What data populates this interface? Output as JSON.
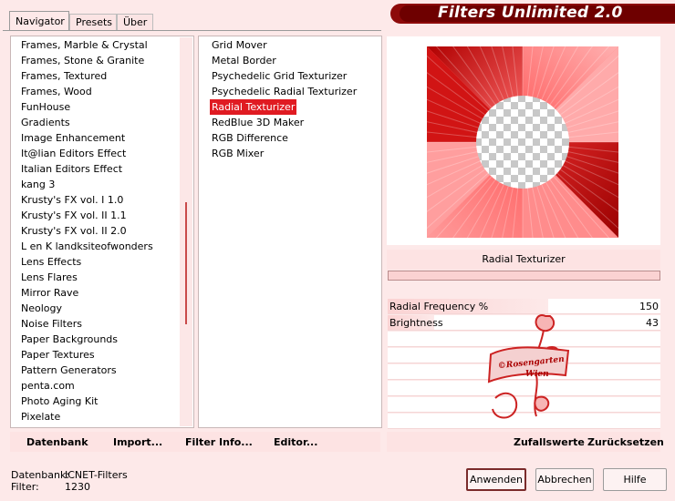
{
  "app": {
    "title": "Filters Unlimited 2.0"
  },
  "tabs": [
    {
      "label": "Navigator"
    },
    {
      "label": "Presets"
    },
    {
      "label": "Über"
    }
  ],
  "categories": [
    "Frames, Marble & Crystal",
    "Frames, Stone & Granite",
    "Frames, Textured",
    "Frames, Wood",
    "FunHouse",
    "Gradients",
    "Image Enhancement",
    "It@lian Editors Effect",
    "Italian Editors Effect",
    "kang 3",
    "Krusty's FX vol. I 1.0",
    "Krusty's FX vol. II 1.1",
    "Krusty's FX vol. II 2.0",
    "L en K landksiteofwonders",
    "Lens Effects",
    "Lens Flares",
    "Mirror Rave",
    "Neology",
    "Noise Filters",
    "Paper Backgrounds",
    "Paper Textures",
    "Pattern Generators",
    "penta.com",
    "Photo Aging Kit",
    "Pixelate"
  ],
  "filters": [
    {
      "label": "Grid Mover",
      "selected": false
    },
    {
      "label": "Metal Border",
      "selected": false
    },
    {
      "label": "Psychedelic Grid Texturizer",
      "selected": false
    },
    {
      "label": "Psychedelic Radial Texturizer",
      "selected": false
    },
    {
      "label": "Radial Texturizer",
      "selected": true
    },
    {
      "label": "RedBlue 3D Maker",
      "selected": false
    },
    {
      "label": "RGB Difference",
      "selected": false
    },
    {
      "label": "RGB Mixer",
      "selected": false
    }
  ],
  "preview": {
    "filter_name": "Radial Texturizer"
  },
  "params": [
    {
      "label": "Radial Frequency %",
      "value": "150",
      "level": 0.59
    },
    {
      "label": "Brightness",
      "value": "43",
      "level": 0.17
    }
  ],
  "toolbar": {
    "database_label": "Datenbank",
    "import_label": "Import...",
    "filter_info_label": "Filter Info...",
    "editor_label": "Editor...",
    "random_label": "Zufallswerte",
    "reset_label": "Zurücksetzen"
  },
  "status": {
    "database_key": "Datenbank:",
    "database_value": "ICNET-Filters",
    "filter_key": "Filter:",
    "filter_value": "1230"
  },
  "buttons": {
    "apply": "Anwenden",
    "cancel": "Abbrechen",
    "help": "Hilfe"
  },
  "watermark": {
    "line1": "©Rosengarten",
    "line2": "Wien"
  },
  "colors": {
    "accent": "#e01b22",
    "banner": "#7a0000",
    "background": "#fde9e9"
  }
}
